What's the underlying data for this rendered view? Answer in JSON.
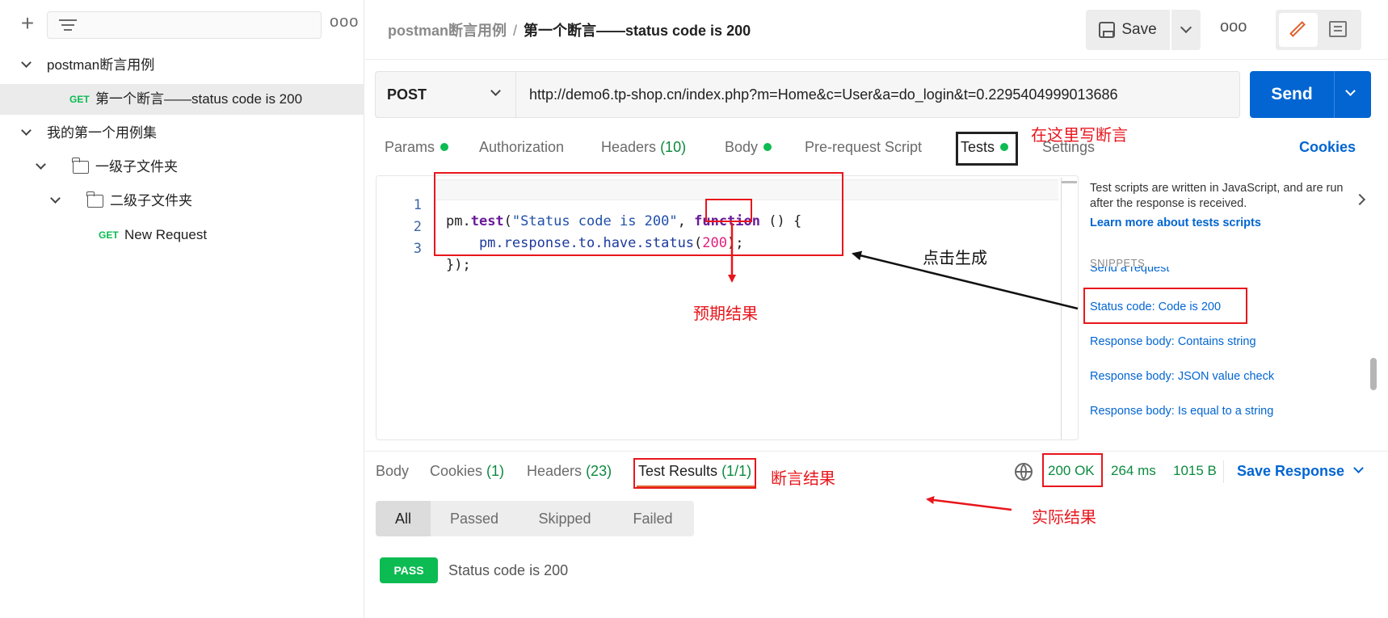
{
  "sidebar": {
    "plus_icon": "plus-icon",
    "filter_icon": "filter-icon",
    "more_label": "ooo",
    "collections": [
      {
        "name": "postman断言用例"
      },
      {
        "method": "GET",
        "name": "第一个断言——status code is 200"
      },
      {
        "name": "我的第一个用例集"
      },
      {
        "name": "一级子文件夹"
      },
      {
        "name": "二级子文件夹"
      },
      {
        "method": "GET",
        "name": "New Request"
      }
    ]
  },
  "header": {
    "breadcrumb_parent": "postman断言用例",
    "breadcrumb_sep": "/",
    "breadcrumb_current": "第一个断言——status code is 200",
    "save_label": "Save",
    "more_label": "ooo"
  },
  "request": {
    "method": "POST",
    "url": "http://demo6.tp-shop.cn/index.php?m=Home&c=User&a=do_login&t=0.2295404999013686",
    "send_label": "Send",
    "tabs": {
      "params": "Params",
      "authorization": "Authorization",
      "headers": "Headers",
      "headers_count": "(10)",
      "body": "Body",
      "prerequest": "Pre-request Script",
      "tests": "Tests",
      "settings": "Settings"
    },
    "cookies_label": "Cookies"
  },
  "editor": {
    "line_numbers": [
      "1",
      "2",
      "3"
    ],
    "line1": {
      "a": "pm.",
      "b": "test",
      "c": "(",
      "d": "\"Status code is 200\"",
      "e": ", ",
      "f": "function",
      "g": " () {"
    },
    "line2": {
      "a": "    pm.response.to.have.status",
      "b": "(",
      "c": "200",
      "d": ");"
    },
    "line3": "});"
  },
  "snippets": {
    "description": "Test scripts are written in JavaScript, and are run after the response is received.",
    "learn_more": "Learn more about tests scripts",
    "heading": "SNIPPETS",
    "clipped_item": "Send a request",
    "items": [
      "Status code: Code is 200",
      "Response body: Contains string",
      "Response body: JSON value check",
      "Response body: Is equal to a string"
    ]
  },
  "response": {
    "tabs": {
      "body": "Body",
      "cookies": "Cookies",
      "cookies_count": "(1)",
      "headers": "Headers",
      "headers_count": "(23)",
      "test_results": "Test Results",
      "test_results_count": "(1/1)"
    },
    "status": "200 OK",
    "time": "264 ms",
    "size": "1015 B",
    "save_response": "Save Response",
    "filters": [
      "All",
      "Passed",
      "Skipped",
      "Failed"
    ],
    "result_badge": "PASS",
    "result_name": "Status code is 200"
  },
  "annotations": {
    "write_here": "在这里写断言",
    "click_generate": "点击生成",
    "expected": "预期结果",
    "assert_result": "断言结果",
    "actual": "实际结果"
  },
  "colors": {
    "accent": "#e0602b",
    "send_blue": "#0265d2",
    "success_green": "#0cbb52",
    "annotation_red": "#e8161c"
  }
}
